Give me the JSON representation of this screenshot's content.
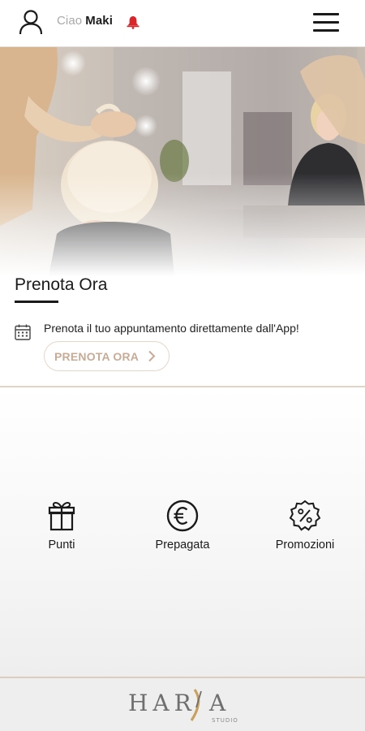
{
  "header": {
    "greeting": "Ciao",
    "user_name": "Maki",
    "icons": {
      "user": "user-icon",
      "bell": "bell-icon",
      "menu": "hamburger-menu-icon"
    }
  },
  "booking": {
    "title": "Prenota Ora",
    "description": "Prenota il tuo appuntamento direttamente dall'App!",
    "button_label": "PRENOTA ORA",
    "icons": {
      "calendar": "calendar-icon",
      "chevron": "chevron-right-icon"
    }
  },
  "features": [
    {
      "label": "Punti",
      "icon": "gift-icon"
    },
    {
      "label": "Prepagata",
      "icon": "euro-coin-icon"
    },
    {
      "label": "Promozioni",
      "icon": "percent-badge-icon"
    }
  ],
  "footer": {
    "logo_text": "HARYA",
    "logo_subtext": "STUDIO"
  },
  "colors": {
    "accent_beige": "#c7ab96",
    "divider": "#e4d3c6",
    "bell_red": "#d8262a",
    "text_dark": "#1a1a1a",
    "greeting_grey": "#a9a9a9"
  }
}
